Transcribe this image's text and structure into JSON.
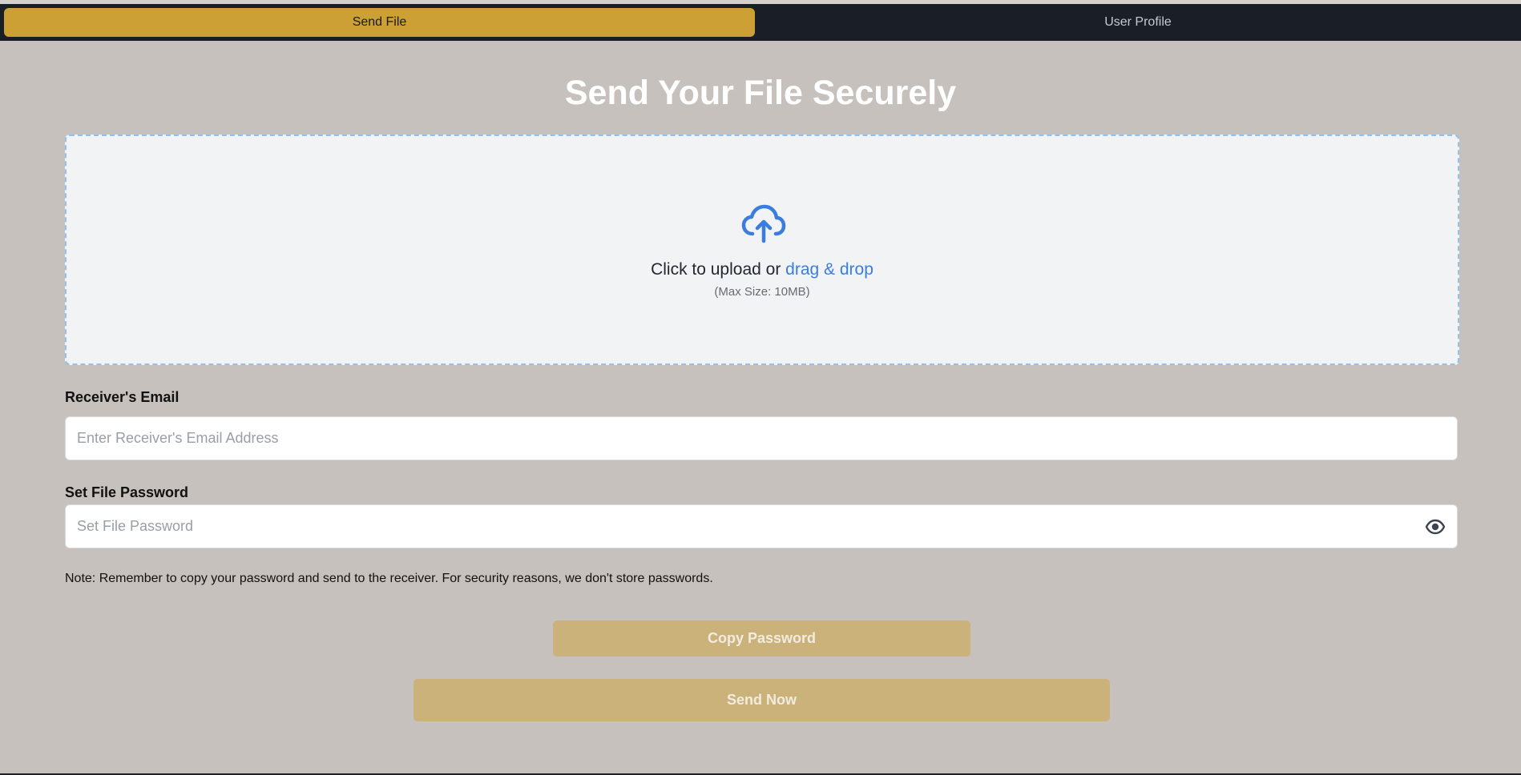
{
  "nav": {
    "tabs": [
      {
        "label": "Send File",
        "active": true
      },
      {
        "label": "User Profile",
        "active": false
      }
    ]
  },
  "page": {
    "title": "Send Your File Securely"
  },
  "upload": {
    "icon": "cloud-upload-icon",
    "prompt_prefix": "Click to upload or",
    "prompt_link": "drag & drop",
    "max_size": "(Max Size: 10MB)"
  },
  "email": {
    "label": "Receiver's Email",
    "placeholder": "Enter Receiver's Email Address",
    "value": ""
  },
  "password": {
    "label": "Set File Password",
    "placeholder": "Set File Password",
    "value": "",
    "toggle_icon": "eye-icon"
  },
  "note": "Note: Remember to copy your password and send to the receiver. For security reasons, we don't store passwords.",
  "buttons": {
    "copy_label": "Copy Password",
    "send_label": "Send Now"
  },
  "colors": {
    "nav_bg": "#191e27",
    "active_tab": "#cca035",
    "page_bg": "#c6c1bc",
    "link": "#3a7ddf",
    "button_disabled": "#cab27a"
  }
}
